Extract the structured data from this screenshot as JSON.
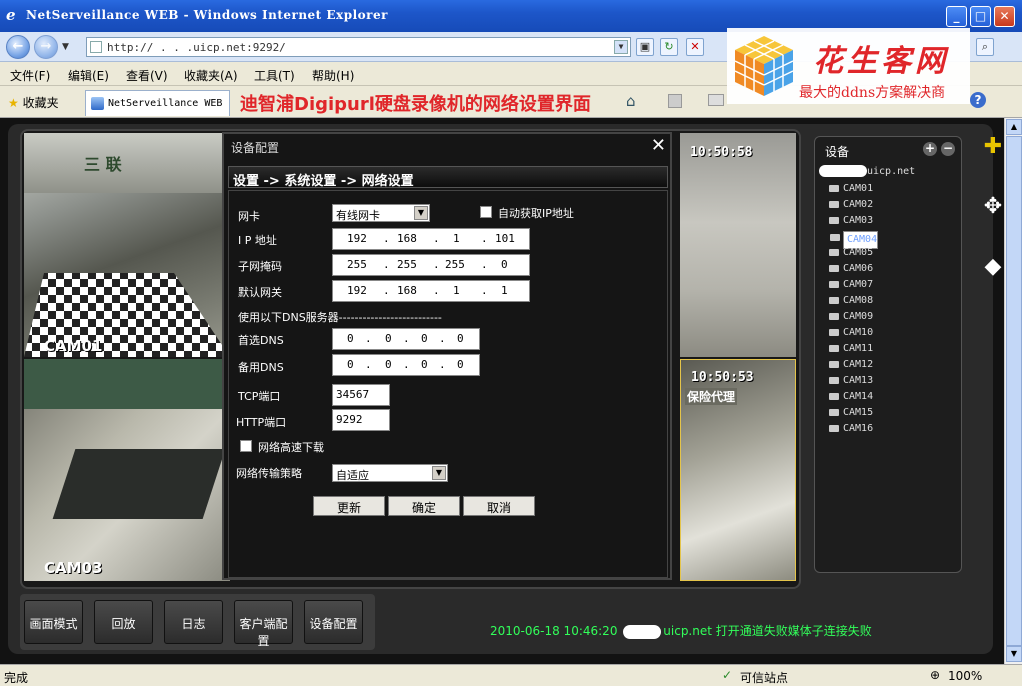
{
  "window": {
    "title": "NetServeillance WEB - Windows Internet Explorer"
  },
  "address": {
    "url": "http://    .  . .uicp.net:9292/"
  },
  "menu": [
    "文件(F)",
    "编辑(E)",
    "查看(V)",
    "收藏夹(A)",
    "工具(T)",
    "帮助(H)"
  ],
  "favorites_label": "收藏夹",
  "tab": {
    "label": "NetServeillance WEB"
  },
  "caption": "迪智浦Digipurl硬盘录像机的网络设置界面",
  "watermark": {
    "title": "花生客网",
    "subtitle": "最大的ddns方案解决商"
  },
  "cams": {
    "cam01": "CAM01",
    "cam03": "CAM03",
    "time1": "10:50:58",
    "time2": "10:50:53",
    "overlay_cn1": "三 联",
    "overlay_cn2": "保险代理"
  },
  "dialog": {
    "title": "设备配置",
    "breadcrumb": "设置 -> 系统设置 -> 网络设置",
    "nic_label": "网卡",
    "nic_value": "有线网卡",
    "auto_ip_label": "自动获取IP地址",
    "ip_label": "I P 地址",
    "ip": [
      "192",
      "168",
      "1",
      "101"
    ],
    "mask_label": "子网掩码",
    "mask": [
      "255",
      "255",
      "255",
      "0"
    ],
    "gw_label": "默认网关",
    "gw": [
      "192",
      "168",
      "1",
      "1"
    ],
    "dns_section": "使用以下DNS服务器--------------------------",
    "dns1_label": "首选DNS",
    "dns1": [
      "0",
      "0",
      "0",
      "0"
    ],
    "dns2_label": "备用DNS",
    "dns2": [
      "0",
      "0",
      "0",
      "0"
    ],
    "tcp_label": "TCP端口",
    "tcp_value": "34567",
    "http_label": "HTTP端口",
    "http_value": "9292",
    "hs_label": "网络高速下载",
    "strategy_label": "网络传输策略",
    "strategy_value": "自适应",
    "btn_update": "更新",
    "btn_ok": "确定",
    "btn_cancel": "取消"
  },
  "devices": {
    "title": "设备",
    "root": "uicp.net",
    "items": [
      "CAM01",
      "CAM02",
      "CAM03",
      "CAM04",
      "CAM05",
      "CAM06",
      "CAM07",
      "CAM08",
      "CAM09",
      "CAM10",
      "CAM11",
      "CAM12",
      "CAM13",
      "CAM14",
      "CAM15",
      "CAM16"
    ],
    "selected": "CAM04"
  },
  "bottom_buttons": [
    "画面模式",
    "回放",
    "日志",
    "客户端配置",
    "设备配置"
  ],
  "status_message": {
    "datetime": "2010-06-18  10:46:20",
    "host": "uicp.net",
    "text": "打开通道失败媒体子连接失败"
  },
  "statusbar": {
    "left": "完成",
    "zone": "可信站点",
    "zoom": "100%"
  },
  "colors": {
    "titlebar": "#1d56c9",
    "status_green": "#32ff5a",
    "caption_red": "#e0262a"
  }
}
